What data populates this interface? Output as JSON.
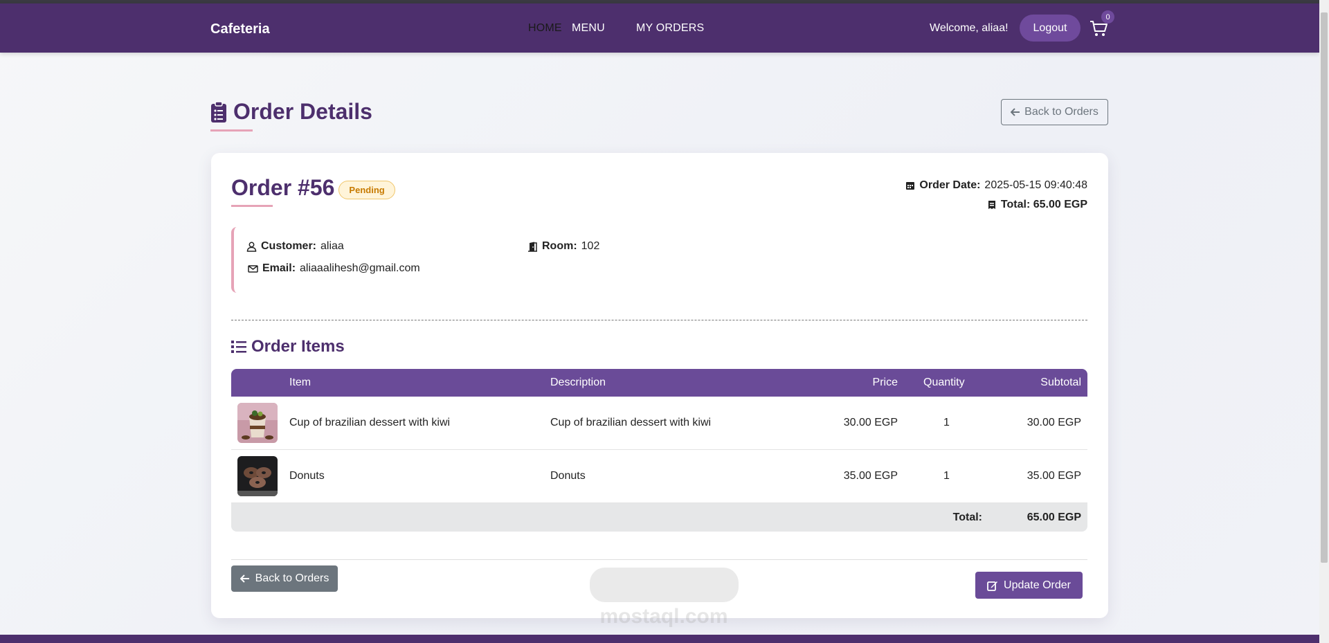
{
  "nav": {
    "brand": "Cafeteria",
    "links": [
      "HOME",
      "MENU",
      "MY ORDERS"
    ],
    "welcome": "Welcome, aliaa!",
    "logout_label": "Logout",
    "cart_count": "0"
  },
  "page": {
    "title": "Order Details",
    "back_top_label": "Back to Orders"
  },
  "order": {
    "heading": "Order #56",
    "status": "Pending",
    "date_label": "Order Date:",
    "date_value": "2025-05-15 09:40:48",
    "total_label": "Total: 65.00 EGP",
    "customer_label": "Customer:",
    "customer_value": "aliaa",
    "room_label": "Room:",
    "room_value": "102",
    "email_label": "Email:",
    "email_value": "aliaaalihesh@gmail.com"
  },
  "items": {
    "heading": "Order Items",
    "columns": [
      "Item",
      "Description",
      "Price",
      "Quantity",
      "Subtotal"
    ],
    "rows": [
      {
        "item": "Cup of brazilian dessert with kiwi",
        "description": "Cup of brazilian dessert with kiwi",
        "price": "30.00 EGP",
        "quantity": "1",
        "subtotal": "30.00 EGP"
      },
      {
        "item": "Donuts",
        "description": "Donuts",
        "price": "35.00 EGP",
        "quantity": "1",
        "subtotal": "35.00 EGP"
      }
    ],
    "total_label": "Total:",
    "total_value": "65.00 EGP"
  },
  "actions": {
    "back_label": "Back to Orders",
    "update_label": "Update Order"
  },
  "watermark": "mostaql.com",
  "colors": {
    "primary": "#4d2f6d",
    "accent": "#6a4b98",
    "pink": "#e6a3b7",
    "pending": "#c77a00"
  }
}
